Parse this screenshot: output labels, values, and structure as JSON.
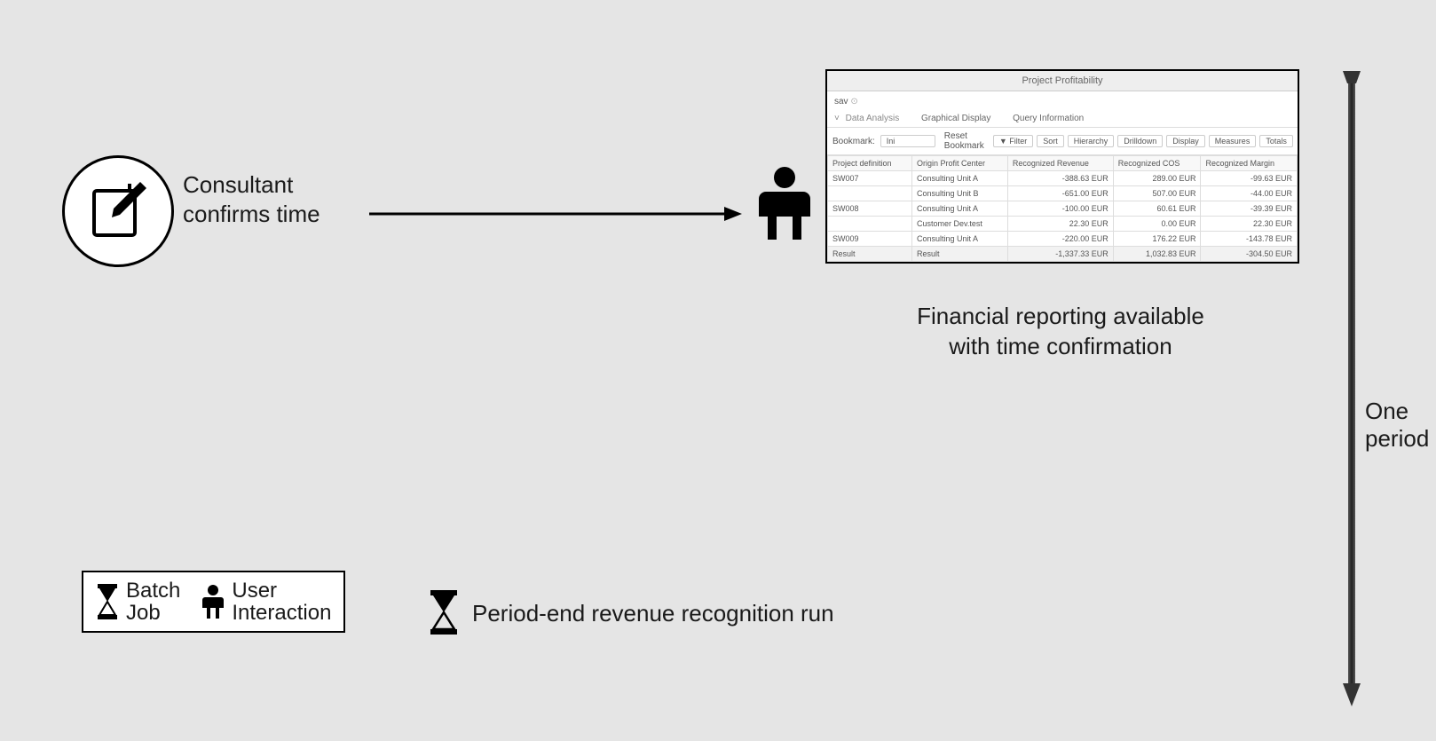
{
  "consultant": {
    "label_l1": "Consultant",
    "label_l2": "confirms time"
  },
  "report": {
    "title": "Project Profitability",
    "saved_hint": "sav",
    "tabs": {
      "data": "Data Analysis",
      "graph": "Graphical Display",
      "query": "Query Information"
    },
    "toolbar": {
      "bookmark_label": "Bookmark:",
      "bookmark_value": "Ini",
      "reset": "Reset Bookmark",
      "filter": "▼ Filter",
      "sort": "Sort",
      "hierarchy": "Hierarchy",
      "drilldown": "Drilldown",
      "display": "Display",
      "measures": "Measures",
      "totals": "Totals"
    },
    "columns": {
      "projdef": "Project definition",
      "origin": "Origin Profit Center",
      "rev": "Recognized Revenue",
      "cos": "Recognized COS",
      "margin": "Recognized Margin"
    },
    "rows": [
      {
        "proj": "SW007",
        "origin": "Consulting Unit A",
        "rev": "-388.63 EUR",
        "cos": "289.00 EUR",
        "margin": "-99.63 EUR"
      },
      {
        "proj": "",
        "origin": "Consulting Unit B",
        "rev": "-651.00 EUR",
        "cos": "507.00 EUR",
        "margin": "-44.00 EUR"
      },
      {
        "proj": "SW008",
        "origin": "Consulting Unit A",
        "rev": "-100.00 EUR",
        "cos": "60.61 EUR",
        "margin": "-39.39 EUR"
      },
      {
        "proj": "",
        "origin": "Customer Dev.test",
        "rev": "22.30 EUR",
        "cos": "0.00 EUR",
        "margin": "22.30 EUR"
      },
      {
        "proj": "SW009",
        "origin": "Consulting Unit A",
        "rev": "-220.00 EUR",
        "cos": "176.22 EUR",
        "margin": "-143.78 EUR"
      }
    ],
    "result_row": {
      "proj": "Result",
      "origin": "Result",
      "rev": "-1,337.33 EUR",
      "cos": "1,032.83 EUR",
      "margin": "-304.50 EUR"
    },
    "caption_l1": "Financial reporting available",
    "caption_l2": "with time confirmation"
  },
  "timeline": {
    "label": "One period"
  },
  "legend": {
    "batch_l1": "Batch",
    "batch_l2": "Job",
    "user_l1": "User",
    "user_l2": "Interaction"
  },
  "periodend": {
    "label": "Period-end revenue recognition run"
  }
}
